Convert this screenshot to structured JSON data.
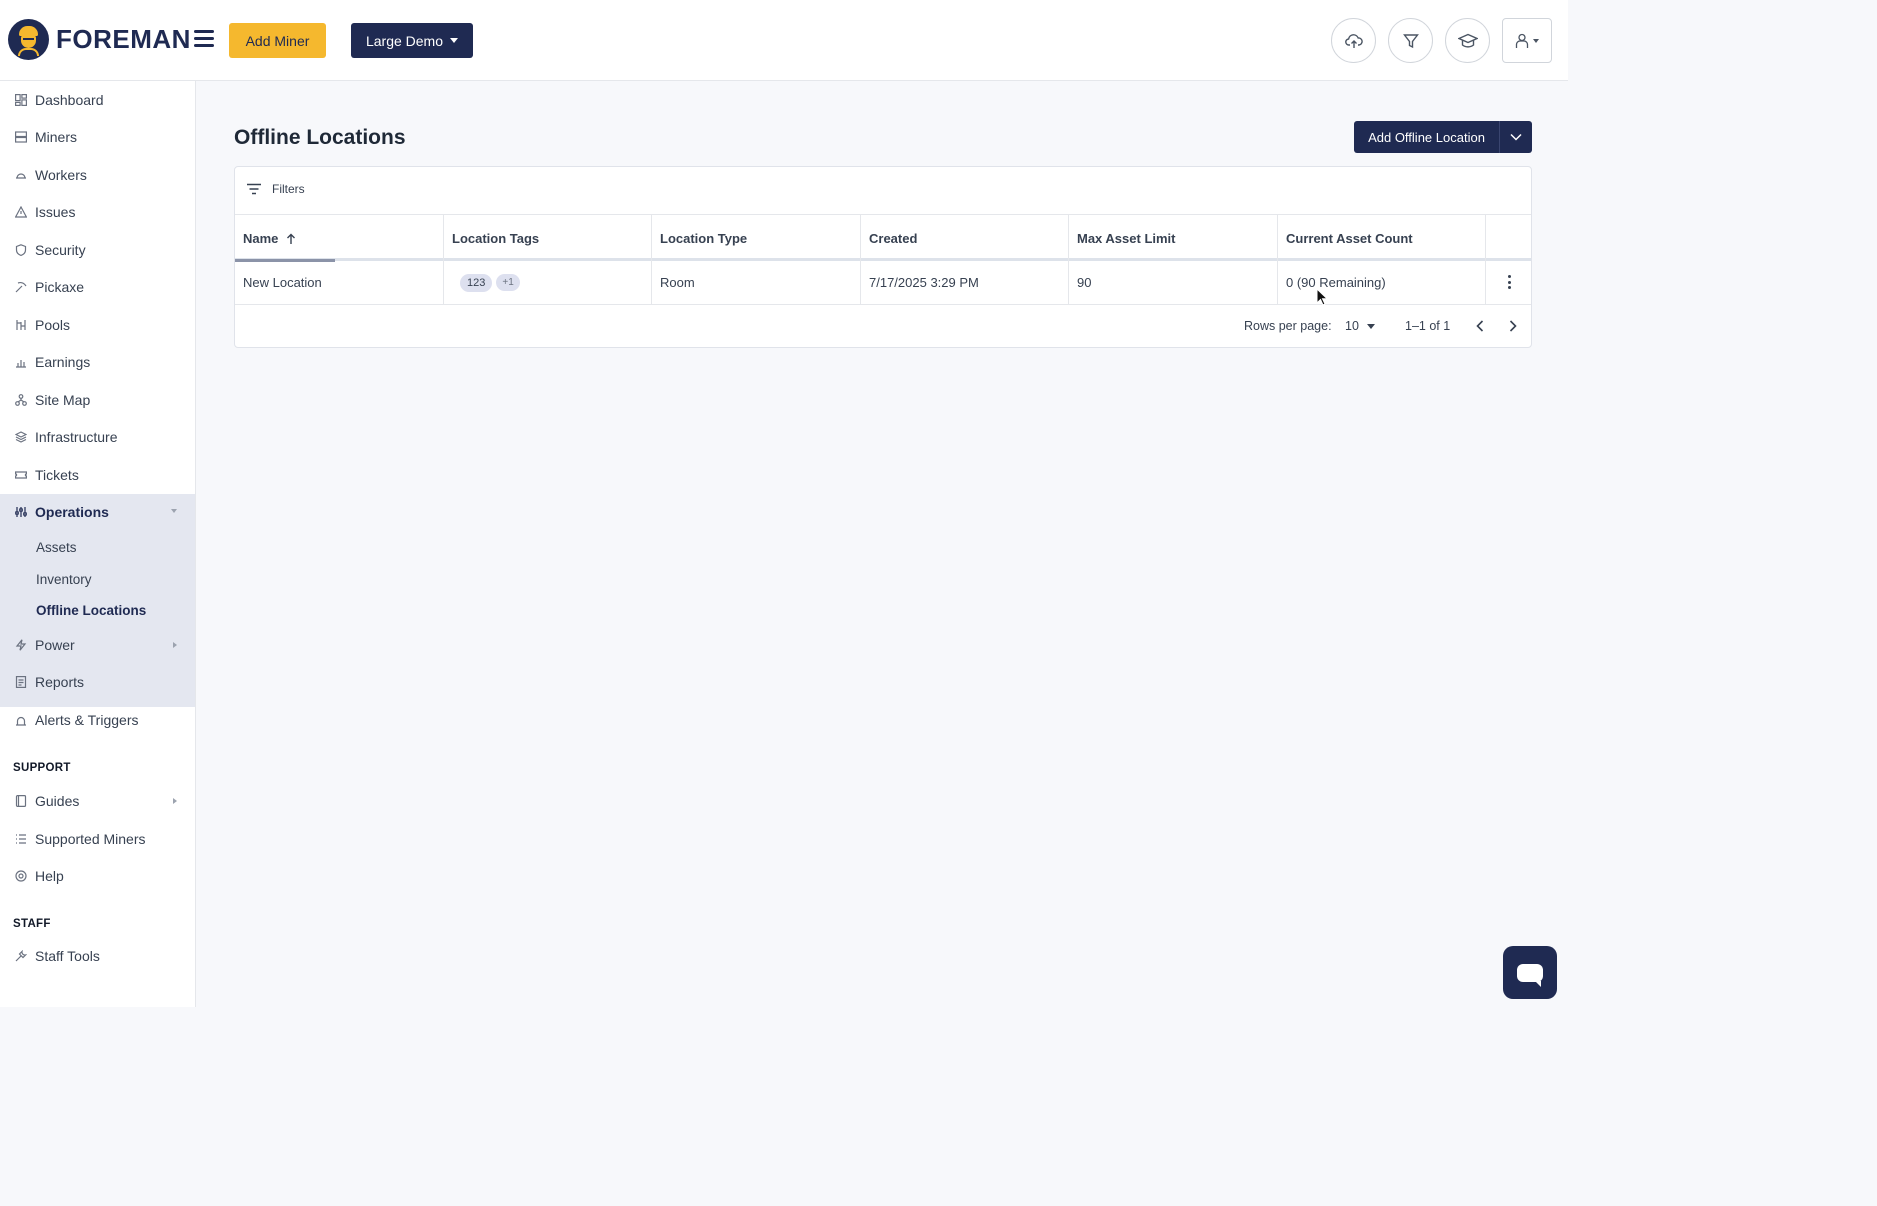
{
  "header": {
    "brand": "FOREMAN",
    "add_miner_label": "Add Miner",
    "org_selector_label": "Large Demo",
    "icons": [
      "upload-cloud-icon",
      "filter-icon",
      "graduation-cap-icon",
      "user-icon"
    ]
  },
  "sidebar": {
    "items": [
      {
        "label": "Dashboard",
        "icon": "dashboard-icon"
      },
      {
        "label": "Miners",
        "icon": "server-icon"
      },
      {
        "label": "Workers",
        "icon": "helmet-icon"
      },
      {
        "label": "Issues",
        "icon": "warning-icon"
      },
      {
        "label": "Security",
        "icon": "shield-icon"
      },
      {
        "label": "Pickaxe",
        "icon": "pickaxe-icon"
      },
      {
        "label": "Pools",
        "icon": "pools-icon"
      },
      {
        "label": "Earnings",
        "icon": "earnings-icon"
      },
      {
        "label": "Site Map",
        "icon": "sitemap-icon"
      },
      {
        "label": "Infrastructure",
        "icon": "layers-icon"
      },
      {
        "label": "Tickets",
        "icon": "ticket-icon"
      }
    ],
    "operations": {
      "label": "Operations",
      "children": [
        "Assets",
        "Inventory",
        "Offline Locations"
      ]
    },
    "items_after": [
      {
        "label": "Power",
        "icon": "bolt-icon"
      },
      {
        "label": "Reports",
        "icon": "report-icon"
      },
      {
        "label": "Alerts & Triggers",
        "icon": "alarm-icon"
      }
    ],
    "support_label": "SUPPORT",
    "support_items": [
      {
        "label": "Guides",
        "icon": "book-icon"
      },
      {
        "label": "Supported Miners",
        "icon": "list-icon"
      },
      {
        "label": "Help",
        "icon": "lifebuoy-icon"
      }
    ],
    "staff_label": "STAFF",
    "staff_items": [
      {
        "label": "Staff Tools",
        "icon": "wrench-icon"
      }
    ]
  },
  "main": {
    "title": "Offline Locations",
    "add_button_label": "Add Offline Location",
    "filters_label": "Filters",
    "columns": [
      "Name",
      "Location Tags",
      "Location Type",
      "Created",
      "Max Asset Limit",
      "Current Asset Count"
    ],
    "rows": [
      {
        "name": "New Location",
        "tags": [
          "123",
          "+1"
        ],
        "type": "Room",
        "created": "7/17/2025 3:29 PM",
        "max_asset_limit": "90",
        "current_asset_count": "0 (90 Remaining)"
      }
    ],
    "pagination": {
      "rows_per_page_label": "Rows per page:",
      "rows_per_page_value": "10",
      "range": "1–1 of 1"
    }
  },
  "colors": {
    "brand_navy": "#1f2a52",
    "brand_yellow": "#f5b82e"
  }
}
